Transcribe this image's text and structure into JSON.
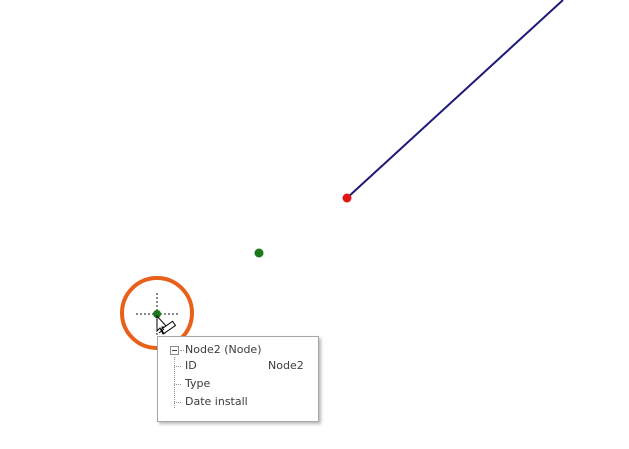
{
  "colors": {
    "edge_line": "#1e1a7a",
    "selected_node": "#e01515",
    "node": "#1a7a1a",
    "highlight_ring": "#e8601a",
    "crosshair": "#111111"
  },
  "cursor": {
    "icon": "pointer-with-pipe-icon"
  },
  "tooltip": {
    "root_label": "Node2 (Node)",
    "collapse_icon": "minus-box-icon",
    "rows": [
      {
        "key": "ID",
        "value": "Node2"
      },
      {
        "key": "Type",
        "value": ""
      },
      {
        "key": "Date install",
        "value": ""
      }
    ]
  }
}
